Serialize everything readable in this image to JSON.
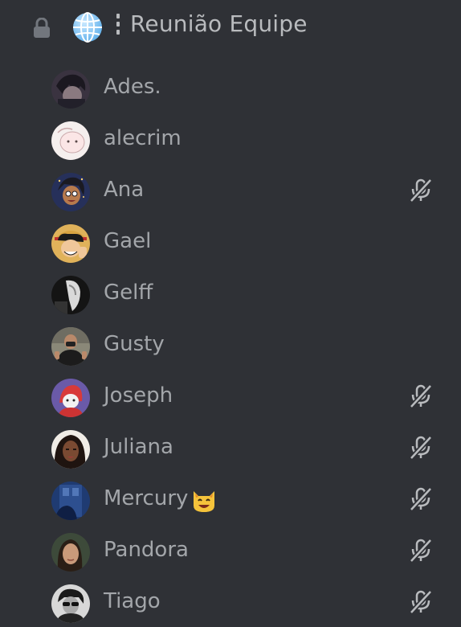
{
  "channel": {
    "name": "Reunião Equipe",
    "lock_icon": "lock-icon",
    "globe_icon": "globe-icon"
  },
  "colors": {
    "background": "#2f3136",
    "text": "#b9bbbe",
    "muted_icon": "#b9bbbe"
  },
  "users": [
    {
      "name": "Ades.",
      "muted": false
    },
    {
      "name": "alecrim",
      "muted": false
    },
    {
      "name": "Ana",
      "muted": true
    },
    {
      "name": "Gael",
      "muted": false
    },
    {
      "name": "Gelff",
      "muted": false
    },
    {
      "name": "Gusty",
      "muted": false
    },
    {
      "name": "Joseph",
      "muted": true
    },
    {
      "name": "Juliana",
      "muted": true
    },
    {
      "name": "Mercury",
      "muted": true,
      "emoji": "cat-face-emoji"
    },
    {
      "name": "Pandora",
      "muted": true
    },
    {
      "name": "Tiago",
      "muted": true
    }
  ]
}
